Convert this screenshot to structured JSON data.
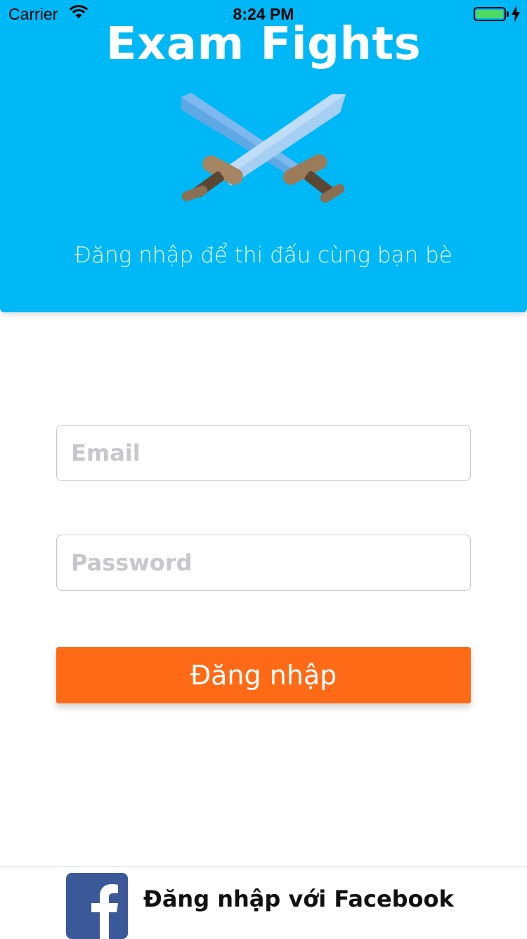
{
  "status_bar": {
    "carrier": "Carrier",
    "time": "8:24 PM",
    "battery_color": "#4CD964"
  },
  "header": {
    "title": "Exam Fights",
    "subtitle": "Đăng nhập để thi đấu cùng bạn bè",
    "icon": "crossed-swords-icon",
    "background": "#00B8F5"
  },
  "form": {
    "email_placeholder": "Email",
    "password_placeholder": "Password",
    "login_label": "Đăng nhập",
    "login_color": "#FF6A16"
  },
  "facebook": {
    "label": "Đăng nhập với Facebook",
    "icon": "facebook-logo-icon",
    "brand_color": "#3B5998"
  }
}
